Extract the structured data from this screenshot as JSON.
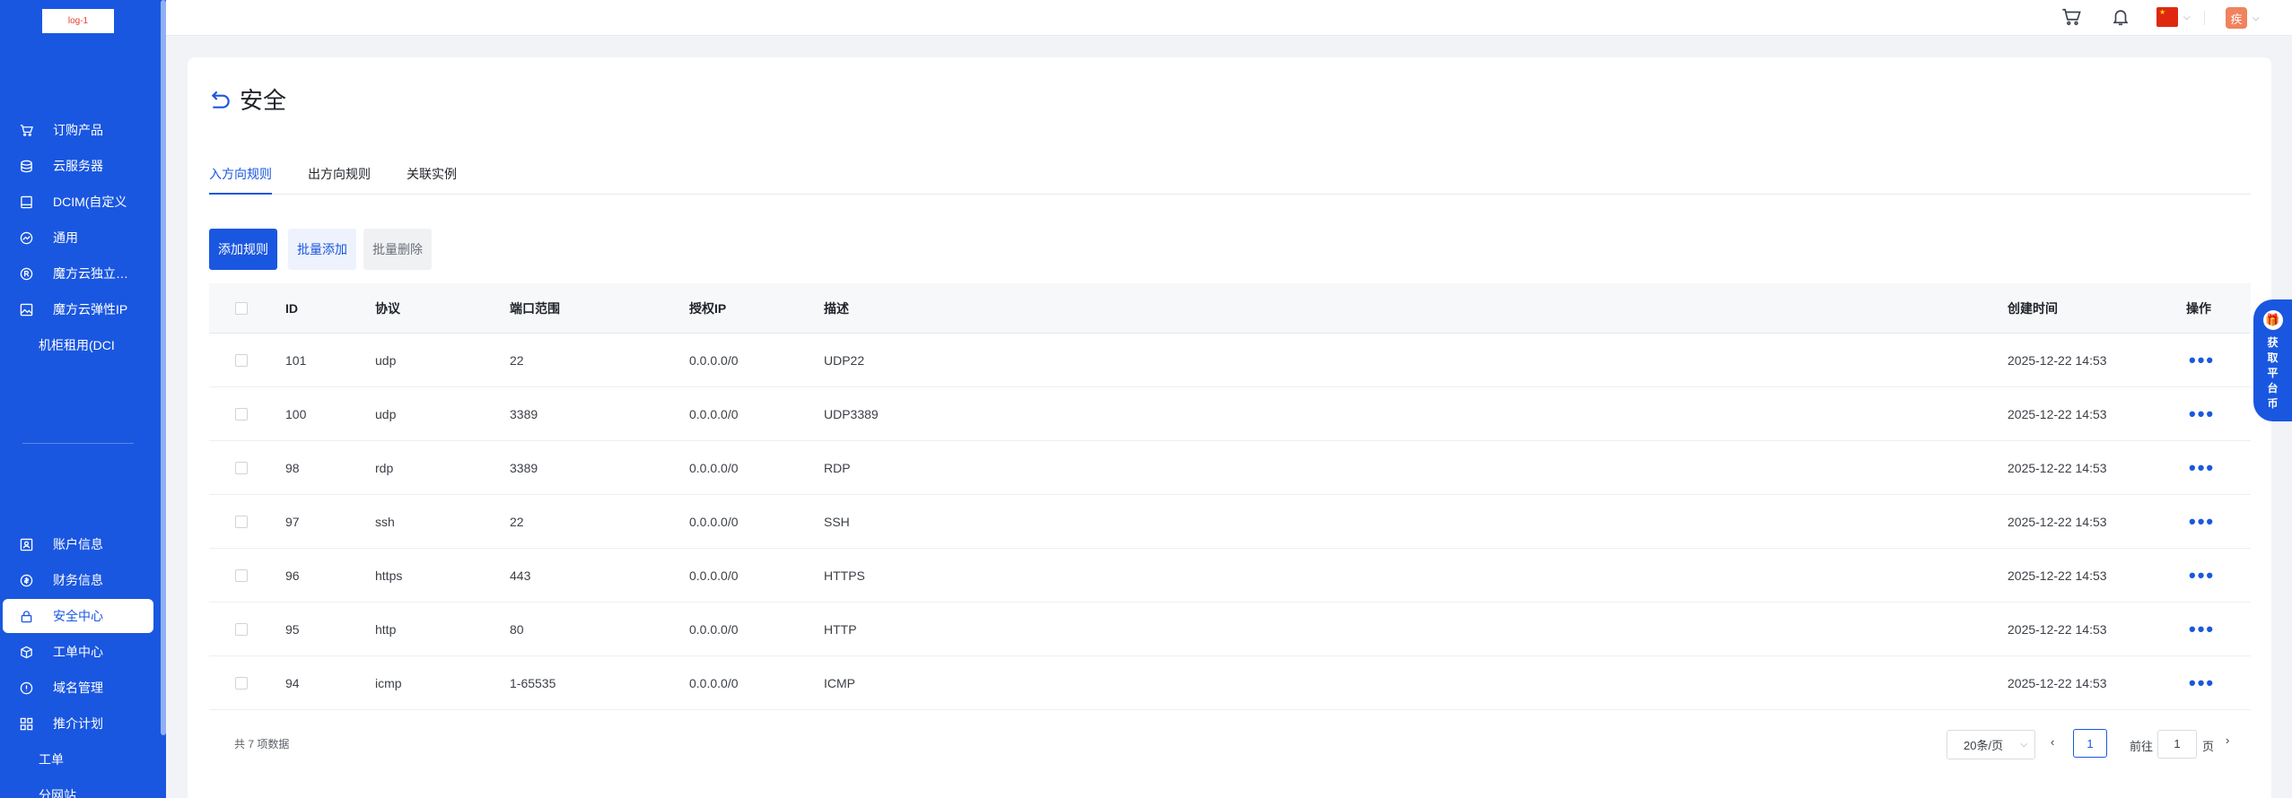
{
  "sidebar": {
    "logo_text": "log-1",
    "items": [
      {
        "label": "订购产品",
        "icon": "cart-icon"
      },
      {
        "label": "云服务器",
        "icon": "stack-icon"
      },
      {
        "label": "DCIM(自定义",
        "icon": "bookmark-icon"
      },
      {
        "label": "通用",
        "icon": "chart-icon"
      },
      {
        "label": "魔方云独立…",
        "icon": "registered-icon"
      },
      {
        "label": "魔方云弹性IP",
        "icon": "image-icon"
      },
      {
        "label": "机柜租用(DCI",
        "icon": ""
      }
    ],
    "bottom_items": [
      {
        "label": "账户信息",
        "icon": "user-card-icon"
      },
      {
        "label": "财务信息",
        "icon": "coin-icon"
      },
      {
        "label": "安全中心",
        "icon": "lock-icon"
      },
      {
        "label": "工单中心",
        "icon": "cube-icon"
      },
      {
        "label": "域名管理",
        "icon": "info-icon"
      },
      {
        "label": "推介计划",
        "icon": "grid-icon"
      },
      {
        "label": "工单",
        "icon": ""
      },
      {
        "label": "分网站",
        "icon": ""
      }
    ]
  },
  "header": {
    "avatar_text": "疾",
    "cart_icon": "cart-icon",
    "bell_icon": "bell-icon",
    "flag": "china-flag-icon"
  },
  "page": {
    "title": "安全",
    "tabs": [
      "入方向规则",
      "出方向规则",
      "关联实例"
    ],
    "buttons": {
      "add": "添加规则",
      "batch_add": "批量添加",
      "batch_delete": "批量删除"
    }
  },
  "table": {
    "headers": {
      "id": "ID",
      "protocol": "协议",
      "port": "端口范围",
      "ip": "授权IP",
      "desc": "描述",
      "created": "创建时间",
      "ops": "操作"
    },
    "rows": [
      {
        "id": "101",
        "protocol": "udp",
        "port": "22",
        "ip": "0.0.0.0/0",
        "desc": "UDP22",
        "created": "2025-12-22 14:53"
      },
      {
        "id": "100",
        "protocol": "udp",
        "port": "3389",
        "ip": "0.0.0.0/0",
        "desc": "UDP3389",
        "created": "2025-12-22 14:53"
      },
      {
        "id": "98",
        "protocol": "rdp",
        "port": "3389",
        "ip": "0.0.0.0/0",
        "desc": "RDP",
        "created": "2025-12-22 14:53"
      },
      {
        "id": "97",
        "protocol": "ssh",
        "port": "22",
        "ip": "0.0.0.0/0",
        "desc": "SSH",
        "created": "2025-12-22 14:53"
      },
      {
        "id": "96",
        "protocol": "https",
        "port": "443",
        "ip": "0.0.0.0/0",
        "desc": "HTTPS",
        "created": "2025-12-22 14:53"
      },
      {
        "id": "95",
        "protocol": "http",
        "port": "80",
        "ip": "0.0.0.0/0",
        "desc": "HTTP",
        "created": "2025-12-22 14:53"
      },
      {
        "id": "94",
        "protocol": "icmp",
        "port": "1-65535",
        "ip": "0.0.0.0/0",
        "desc": "ICMP",
        "created": "2025-12-22 14:53"
      }
    ],
    "more_label": "•••"
  },
  "pagination": {
    "total": "共 7 项数据",
    "page_size": "20条/页",
    "current_page": "1",
    "goto_label": "前往",
    "goto_value": "1",
    "page_suffix": "页"
  },
  "float_widget": {
    "chars": [
      "获",
      "取",
      "平",
      "台",
      "币"
    ]
  },
  "colors": {
    "brand": "#1a57e0"
  }
}
